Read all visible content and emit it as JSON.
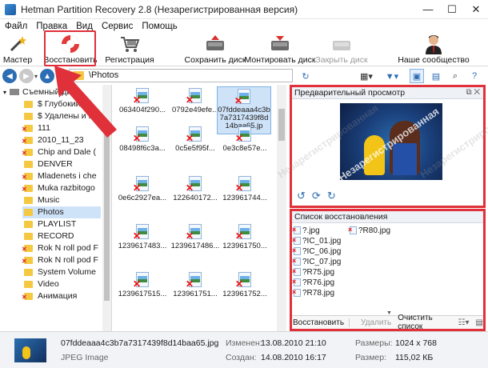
{
  "window": {
    "title": "Hetman Partition Recovery 2.8 (Незарегистрированная версия)",
    "minimize": "—",
    "maximize": "☐",
    "close": "✕"
  },
  "menu": [
    "Файл",
    "Правка",
    "Вид",
    "Сервис",
    "Помощь"
  ],
  "toolbar": {
    "wizard": "Мастер",
    "restore": "Восстановить",
    "register": "Регистрация",
    "save_disk": "Сохранить диск",
    "mount_disk": "Монтировать диск",
    "close_disk": "Закрыть диск",
    "community": "Наше сообщество"
  },
  "address": {
    "path": "\\Photos"
  },
  "tree": {
    "items": [
      {
        "label": "Съемный ди",
        "deleted": false
      },
      {
        "label": "$ Глубокий ан",
        "deleted": false
      },
      {
        "label": "$ Удалены и на",
        "deleted": false
      },
      {
        "label": "111",
        "deleted": true
      },
      {
        "label": "2010_11_23",
        "deleted": true
      },
      {
        "label": "Chip and Dale (",
        "deleted": true
      },
      {
        "label": "DENVER",
        "deleted": false
      },
      {
        "label": "Mladenets i che",
        "deleted": true
      },
      {
        "label": "Muka razbitogo",
        "deleted": true
      },
      {
        "label": "Music",
        "deleted": false
      },
      {
        "label": "Photos",
        "deleted": false
      },
      {
        "label": "PLAYLIST",
        "deleted": false
      },
      {
        "label": "RECORD",
        "deleted": false
      },
      {
        "label": "Rok N roll pod F",
        "deleted": true
      },
      {
        "label": "Rok N roll pod F",
        "deleted": true
      },
      {
        "label": "System Volume",
        "deleted": false
      },
      {
        "label": "Video",
        "deleted": false
      },
      {
        "label": "Анимация",
        "deleted": true
      }
    ]
  },
  "files": [
    "063404f290...",
    "0792e49efe...",
    "07fddeaaa4c3b7a7317439f8d14baa65.jp",
    "08498f6c3a...",
    "0c5e5f95f...",
    "0e3c8e57e...",
    "0e6c2927ea...",
    "122640172...",
    "123961744...",
    "1239617483...",
    "1239617486...",
    "123961750...",
    "1239617515...",
    "123961751...",
    "123961752..."
  ],
  "preview": {
    "title": "Предварительный просмотр",
    "watermark": "Незарегистрированная"
  },
  "recovery_list": {
    "title": "Список восстановления",
    "items": [
      "?.jpg",
      "?IC_01.jpg",
      "?IC_06.jpg",
      "?IC_07.jpg",
      "?R75.jpg",
      "?R76.jpg",
      "?R78.jpg",
      "?R80.jpg"
    ],
    "restore": "Восстановить",
    "delete": "Удалить",
    "clear": "Очистить список"
  },
  "status": {
    "filename": "07fddeaaa4c3b7a7317439f8d14baa65.jpg",
    "type": "JPEG Image",
    "modified_label": "Изменен:",
    "modified_value": "13.08.2010 21:10",
    "created_label": "Создан:",
    "created_value": "14.08.2010 16:17",
    "dims_label": "Размеры:",
    "dims_value": "1024 x 768",
    "size_label": "Размер:",
    "size_value": "115,02 КБ"
  },
  "colors": {
    "highlight": "#e0303a",
    "selection": "#cfe3f8",
    "accent": "#2d6db4"
  }
}
